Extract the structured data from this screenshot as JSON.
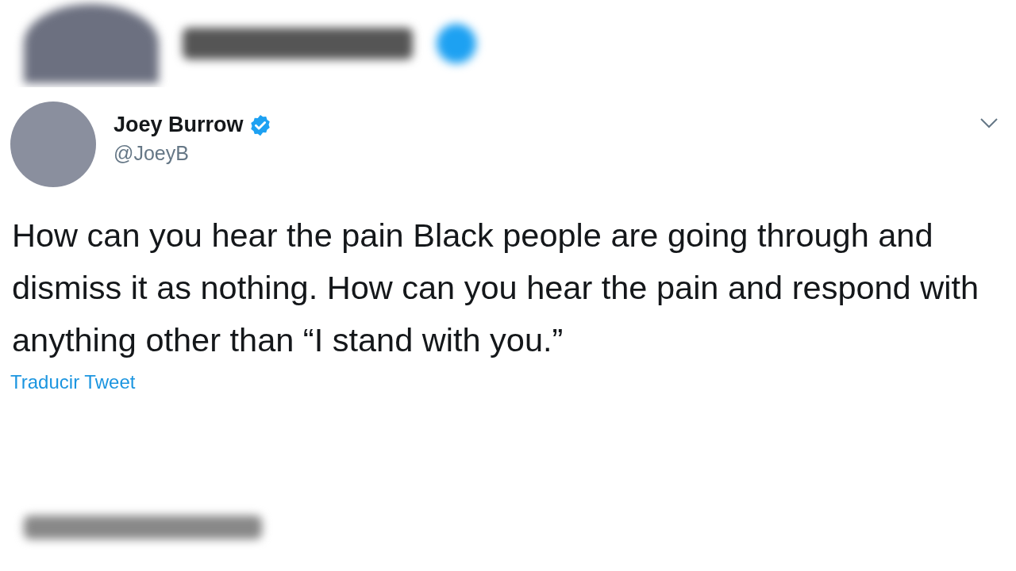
{
  "tweet": {
    "author": {
      "name": "Joey Burrow",
      "handle": "@JoeyB",
      "verified": true
    },
    "text": "How can you hear the pain Black people are going through and dismiss it as nothing. How can you hear the pain and respond with anything other than “I stand with you.”",
    "translate_link": "Traducir Tweet"
  }
}
